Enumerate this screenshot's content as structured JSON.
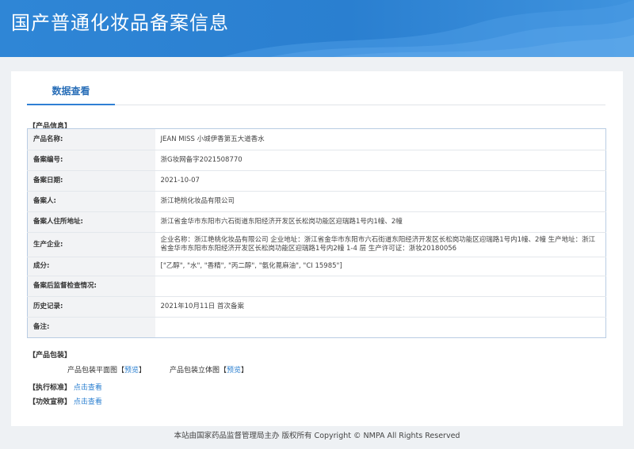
{
  "header": {
    "title": "国产普通化妆品备案信息"
  },
  "tab": {
    "label": "数据查看"
  },
  "sections": {
    "product_info": "【产品信息】",
    "product_package": "【产品包装】",
    "standard": "【执行标准】",
    "efficacy": "【功效宣称】"
  },
  "rows": [
    {
      "key": "产品名称:",
      "value": "JEAN MISS 小城伊香第五大道香水"
    },
    {
      "key": "备案编号:",
      "value": "浙G妆网备字2021508770"
    },
    {
      "key": "备案日期:",
      "value": "2021-10-07"
    },
    {
      "key": "备案人:",
      "value": "浙江艳桃化妆品有限公司"
    },
    {
      "key": "备案人住所地址:",
      "value": "浙江省金华市东阳市六石街道东阳经济开发区长松岗功能区迎瑞路1号内1幢、2幢"
    },
    {
      "key": "生产企业:",
      "value": "企业名称：浙江艳桃化妆品有限公司 企业地址：浙江省金华市东阳市六石街道东阳经济开发区长松岗功能区迎瑞路1号内1幢、2幢 生产地址：浙江省金华市东阳市东阳经济开发区长松岗功能区迎瑞路1号内2幢 1-4 层 生产许可证：浙妆20180056"
    },
    {
      "key": "成分:",
      "value": "[\"乙醇\", \"水\", \"香精\", \"丙二醇\", \"氨化蓖麻油\", \"CI 15985\"]"
    },
    {
      "key": "备案后监督检查情况:",
      "value": ""
    },
    {
      "key": "历史记录:",
      "value": "2021年10月11日 首次备案"
    },
    {
      "key": "备注:",
      "value": ""
    }
  ],
  "package": {
    "flat_label": "产品包装平面图",
    "solid_label": "产品包装立体图",
    "bracket_open": "【",
    "bracket_close": "】",
    "preview": "预览"
  },
  "links": {
    "view": "点击查看"
  },
  "footer": {
    "text": "本站由国家药品监督管理局主办 版权所有 Copyright © NMPA All Rights Reserved"
  },
  "colors": {
    "header": "#2f86d6",
    "link": "#2a7fd0",
    "tab_accent": "#2f7fd4"
  }
}
